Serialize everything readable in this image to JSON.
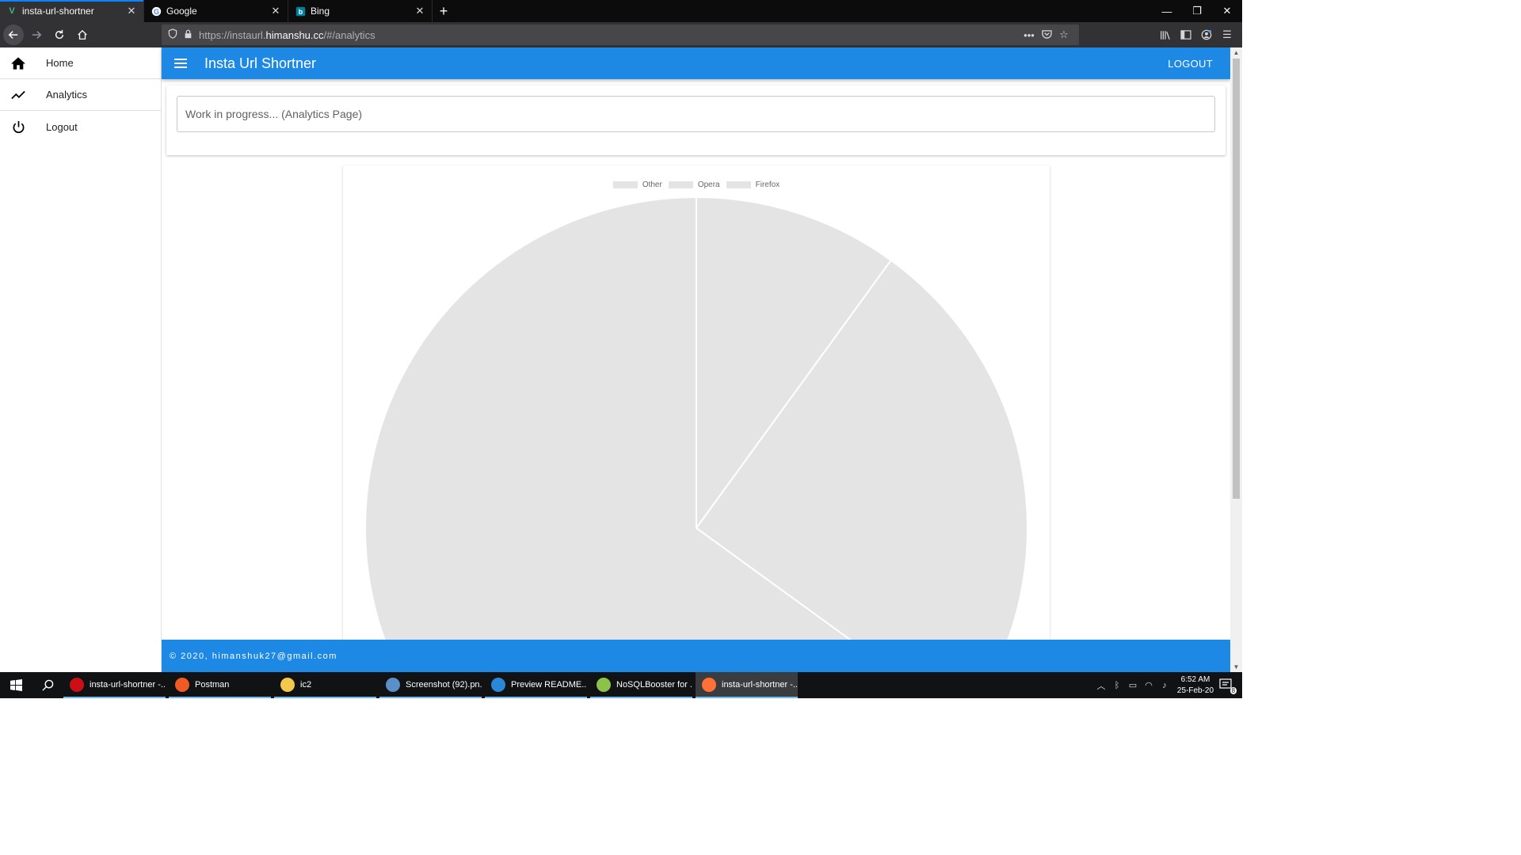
{
  "browser": {
    "tabs": [
      {
        "title": "insta-url-shortner",
        "active": true,
        "icon": "vue-icon"
      },
      {
        "title": "Google",
        "active": false,
        "icon": "google-icon"
      },
      {
        "title": "Bing",
        "active": false,
        "icon": "bing-icon"
      }
    ],
    "url_prefix": "https://instaurl.",
    "url_host": "himanshu.cc",
    "url_suffix": "/#/analytics"
  },
  "sidebar": {
    "items": [
      {
        "label": "Home",
        "icon": "home-icon"
      },
      {
        "label": "Analytics",
        "icon": "trending-icon"
      },
      {
        "label": "Logout",
        "icon": "power-icon"
      }
    ]
  },
  "appbar": {
    "title": "Insta Url Shortner",
    "logout_label": "LOGOUT"
  },
  "main": {
    "wip_text": "Work in progress... (Analytics Page)"
  },
  "chart_data": {
    "type": "pie",
    "categories": [
      "Other",
      "Opera",
      "Firefox"
    ],
    "values": [
      10,
      25,
      65
    ],
    "legend_position": "top",
    "colors": [
      "#e4e4e4",
      "#e4e4e4",
      "#e4e4e4"
    ]
  },
  "footer": {
    "text": "© 2020, himanshuk27@gmail.com"
  },
  "taskbar": {
    "apps": [
      {
        "label": "insta-url-shortner -...",
        "icon_color": "#cc0f16",
        "active": false
      },
      {
        "label": "Postman",
        "icon_color": "#ef5b25",
        "active": false
      },
      {
        "label": "ic2",
        "icon_color": "#f2c94c",
        "active": false
      },
      {
        "label": "Screenshot (92).pn...",
        "icon_color": "#5b8fc7",
        "active": false
      },
      {
        "label": "Preview README....",
        "icon_color": "#2b88d8",
        "active": false
      },
      {
        "label": "NoSQLBooster for ...",
        "icon_color": "#8bc34a",
        "active": false
      },
      {
        "label": "insta-url-shortner -...",
        "icon_color": "#ff7139",
        "active": true
      }
    ],
    "time": "6:52 AM",
    "date": "25-Feb-20",
    "notification_count": "8"
  }
}
